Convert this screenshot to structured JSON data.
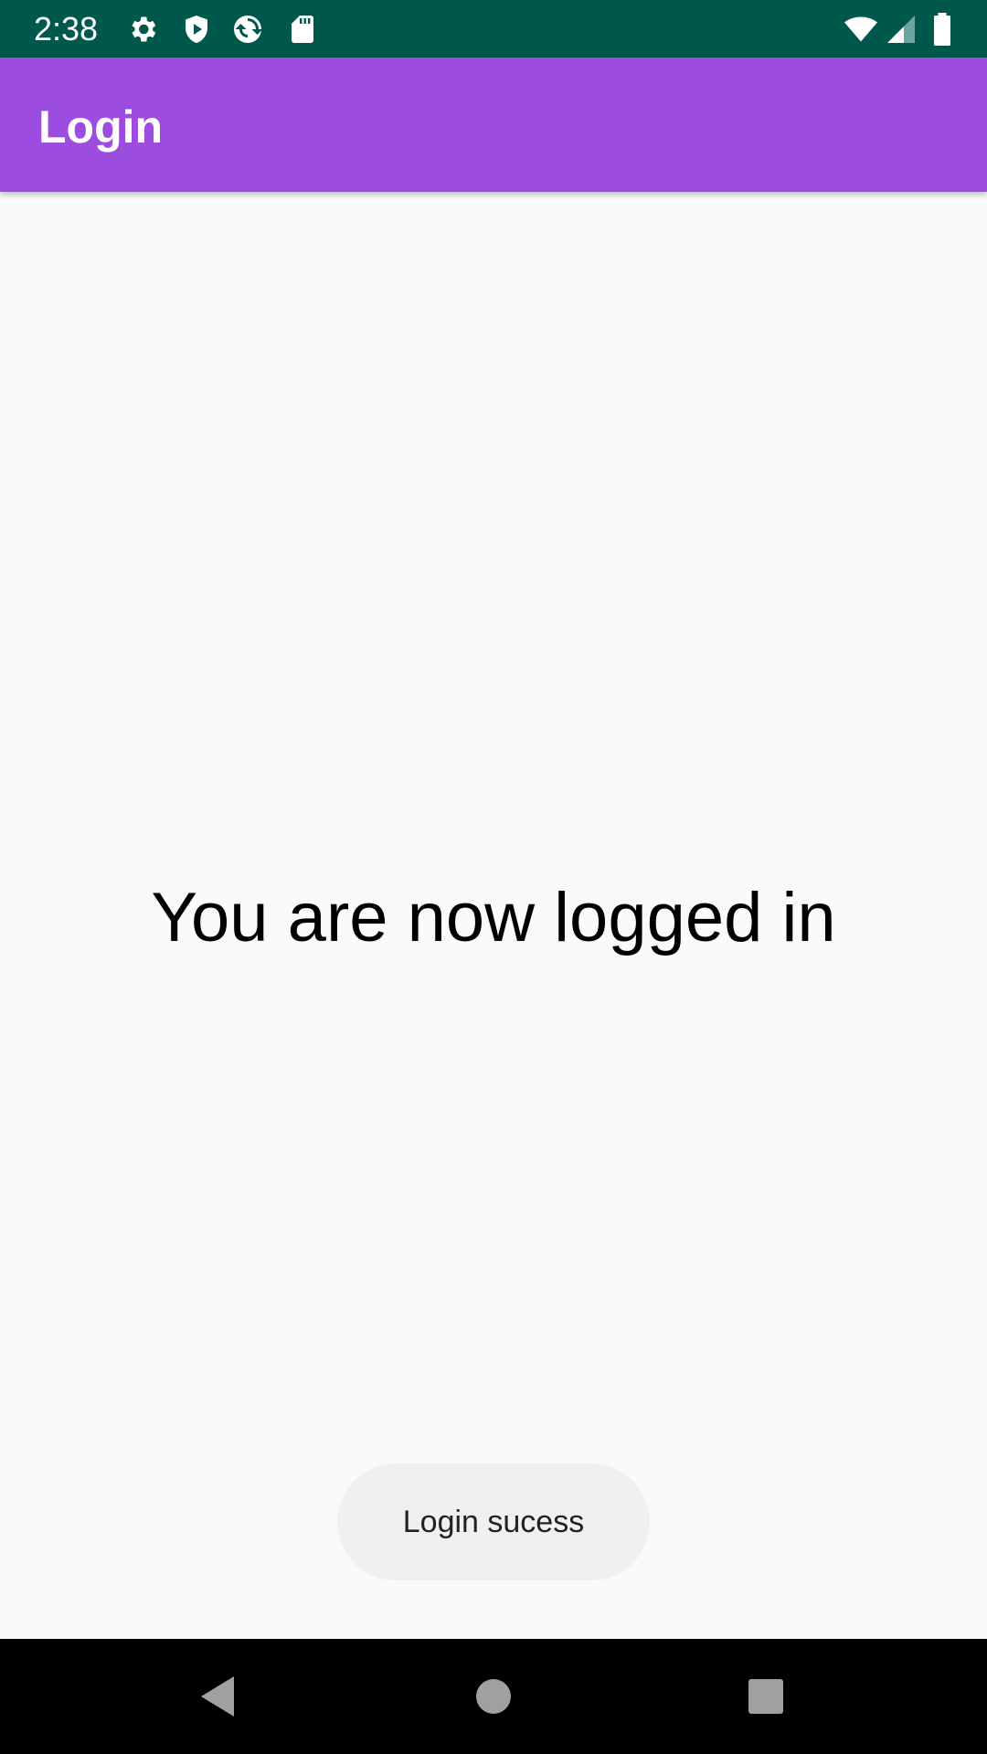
{
  "status_bar": {
    "time": "2:38",
    "icons": [
      "gear-icon",
      "shield-play-icon",
      "sync-icon",
      "sd-card-icon",
      "wifi-icon",
      "signal-icon",
      "battery-icon"
    ],
    "background": "#00574b"
  },
  "app_bar": {
    "title": "Login",
    "background": "#9c4ddf"
  },
  "main": {
    "message": "You are now logged in"
  },
  "toast": {
    "text": "Login sucess"
  },
  "nav_bar": {
    "buttons": [
      "back-icon",
      "home-icon",
      "recents-icon"
    ]
  }
}
